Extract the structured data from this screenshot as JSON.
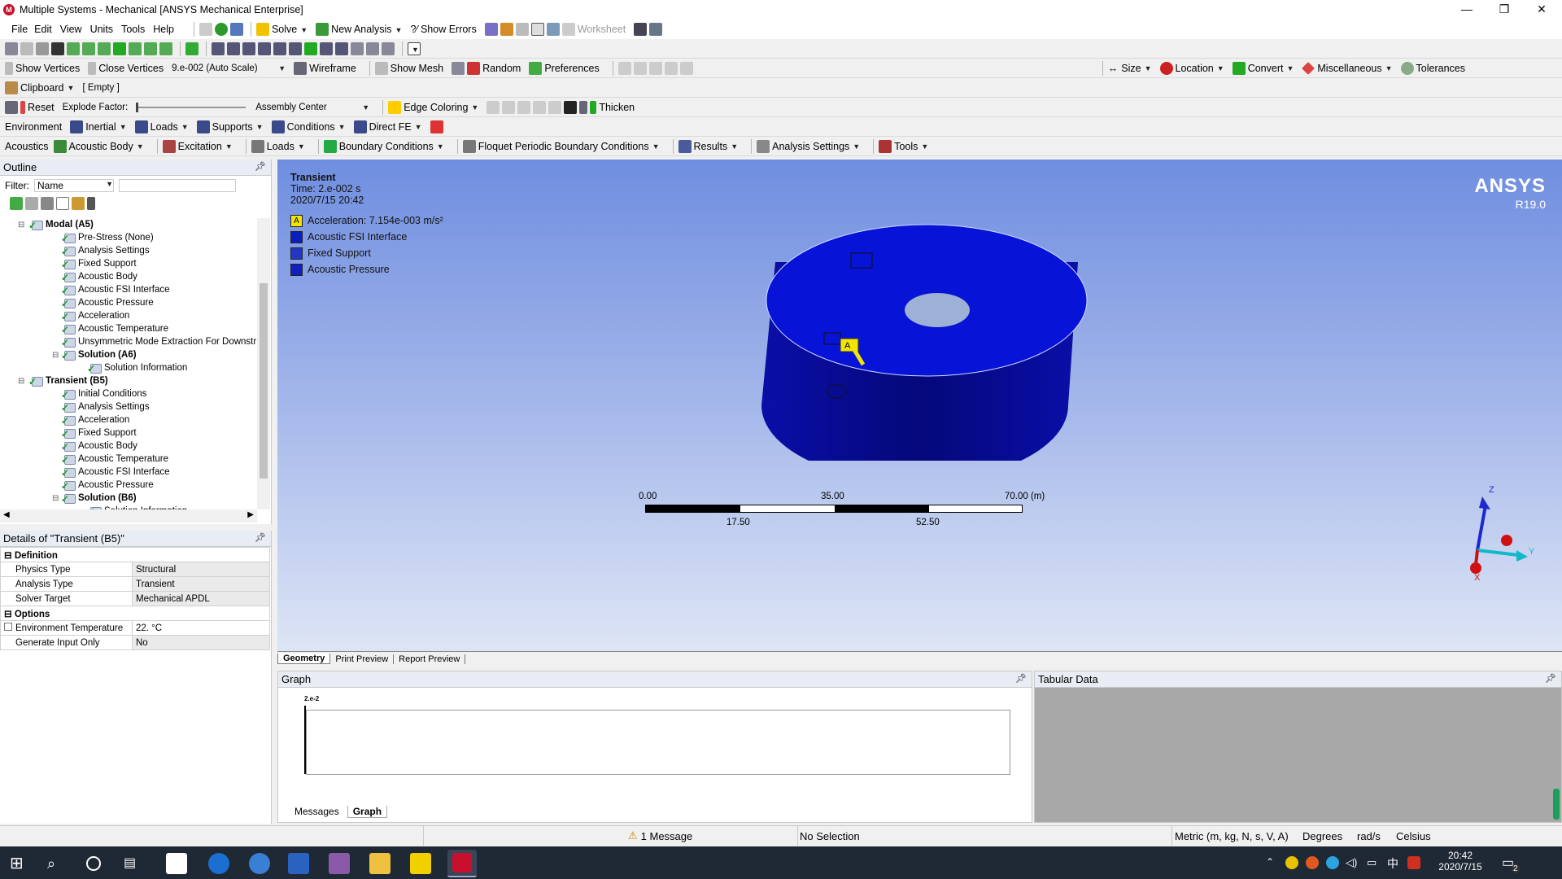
{
  "window": {
    "title": "Multiple Systems - Mechanical [ANSYS Mechanical Enterprise]",
    "logo": "M"
  },
  "menu": [
    "File",
    "Edit",
    "View",
    "Units",
    "Tools",
    "Help"
  ],
  "toolbar1": {
    "solve": "Solve",
    "new_analysis": "New Analysis",
    "show_errors": "?⁄ Show Errors",
    "worksheet": "Worksheet"
  },
  "toolbar3": {
    "show_vertices": "Show Vertices",
    "close_vertices": "Close Vertices",
    "scale_value": "9.e-002 (Auto Scale)",
    "wireframe": "Wireframe",
    "show_mesh": "Show Mesh",
    "random": "Random",
    "preferences": "Preferences",
    "size": "Size",
    "location": "Location",
    "convert": "Convert",
    "miscellaneous": "Miscellaneous",
    "tolerances": "Tolerances"
  },
  "toolbar4": {
    "clipboard": "Clipboard",
    "clipboard_value": "[ Empty ]"
  },
  "toolbar5": {
    "reset": "Reset",
    "explode_factor": "Explode Factor:",
    "assembly_center": "Assembly Center",
    "edge_coloring": "Edge Coloring",
    "thicken": "Thicken"
  },
  "toolbar6": {
    "environment": "Environment",
    "inertial": "Inertial",
    "loads": "Loads",
    "supports": "Supports",
    "conditions": "Conditions",
    "direct_fe": "Direct FE"
  },
  "toolbar7": {
    "acoustics": "Acoustics",
    "acoustic_body": "Acoustic Body",
    "excitation": "Excitation",
    "loads": "Loads",
    "boundary_conditions": "Boundary Conditions",
    "floquet": "Floquet Periodic Boundary Conditions",
    "results": "Results",
    "analysis_settings": "Analysis Settings",
    "tools": "Tools"
  },
  "outline": {
    "title": "Outline",
    "filter_label": "Filter:",
    "filter_value": "Name",
    "tree": [
      {
        "label": "Modal (A5)",
        "level": 0,
        "bold": true
      },
      {
        "label": "Pre-Stress (None)",
        "level": 1
      },
      {
        "label": "Analysis Settings",
        "level": 1
      },
      {
        "label": "Fixed Support",
        "level": 1
      },
      {
        "label": "Acoustic Body",
        "level": 1
      },
      {
        "label": "Acoustic FSI Interface",
        "level": 1
      },
      {
        "label": "Acoustic Pressure",
        "level": 1
      },
      {
        "label": "Acceleration",
        "level": 1
      },
      {
        "label": "Acoustic Temperature",
        "level": 1
      },
      {
        "label": "Unsymmetric Mode Extraction For Downstr",
        "level": 1
      },
      {
        "label": "Solution (A6)",
        "level": 1,
        "bold": true
      },
      {
        "label": "Solution Information",
        "level": 2
      },
      {
        "label": "Transient (B5)",
        "level": 0,
        "bold": true
      },
      {
        "label": "Initial Conditions",
        "level": 1
      },
      {
        "label": "Analysis Settings",
        "level": 1
      },
      {
        "label": "Acceleration",
        "level": 1
      },
      {
        "label": "Fixed Support",
        "level": 1
      },
      {
        "label": "Acoustic Body",
        "level": 1
      },
      {
        "label": "Acoustic Temperature",
        "level": 1
      },
      {
        "label": "Acoustic FSI Interface",
        "level": 1
      },
      {
        "label": "Acoustic Pressure",
        "level": 1
      },
      {
        "label": "Solution (B6)",
        "level": 1,
        "bold": true
      },
      {
        "label": "Solution Information",
        "level": 2
      }
    ]
  },
  "details": {
    "title": "Details of \"Transient (B5)\"",
    "groups": [
      {
        "name": "Definition",
        "rows": [
          {
            "label": "Physics Type",
            "value": "Structural"
          },
          {
            "label": "Analysis Type",
            "value": "Transient"
          },
          {
            "label": "Solver Target",
            "value": "Mechanical APDL"
          }
        ]
      },
      {
        "name": "Options",
        "rows": [
          {
            "label": "Environment Temperature",
            "value": "22. °C"
          },
          {
            "label": "Generate Input Only",
            "value": "No"
          }
        ]
      }
    ]
  },
  "viewport": {
    "heading": "Transient",
    "time": "Time: 2.e-002 s",
    "date": "2020/7/15 20:42",
    "legend": [
      {
        "key": "A",
        "label": "Acceleration: 7.154e-003 m/s²",
        "color": "#f2e600"
      },
      {
        "key": "B",
        "label": "Acoustic FSI Interface",
        "color": "#0b1fbf"
      },
      {
        "key": "C",
        "label": "Fixed Support",
        "color": "#2436c8"
      },
      {
        "key": "D",
        "label": "Acoustic Pressure",
        "color": "#1020c0"
      }
    ],
    "brand": "ANSYS",
    "version": "R19.0",
    "scale_top": [
      "0.00",
      "35.00",
      "70.00 (m)"
    ],
    "scale_bottom": [
      "17.50",
      "52.50"
    ],
    "axis_z": "Z",
    "axis_y": "Y",
    "axis_x": "X",
    "body_color": "#0a0fb0"
  },
  "view_tabs": [
    "Geometry",
    "Print Preview",
    "Report Preview"
  ],
  "graph": {
    "title": "Graph",
    "tick": "2.e-2",
    "tabs": [
      "Messages",
      "Graph"
    ]
  },
  "tabular": {
    "title": "Tabular Data"
  },
  "status": {
    "message": "1 Message",
    "selection": "No Selection",
    "units": "Metric (m, kg, N, s, V, A)",
    "angle": "Degrees",
    "rate": "rad/s",
    "temp": "Celsius"
  },
  "taskbar": {
    "time": "20:42",
    "date": "2020/7/15",
    "badge": "2"
  }
}
